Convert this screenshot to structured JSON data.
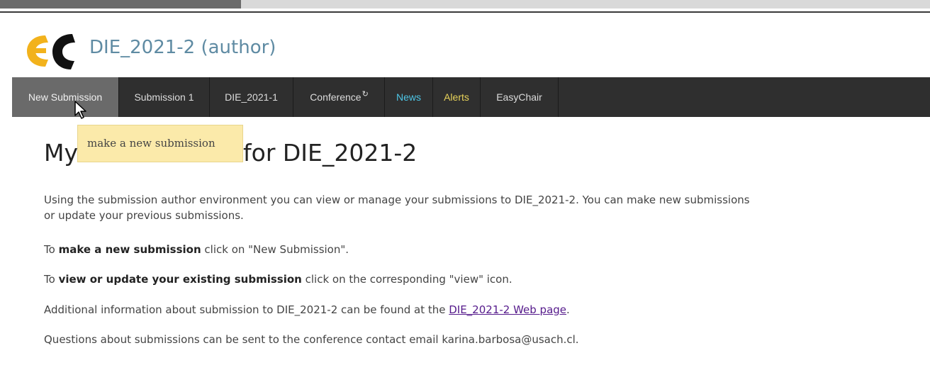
{
  "header": {
    "title": "DIE_2021-2 (author)"
  },
  "menu": {
    "items": [
      {
        "label": "New Submission"
      },
      {
        "label": "Submission 1"
      },
      {
        "label": "DIE_2021-1"
      },
      {
        "label": "Conference"
      },
      {
        "label": "News"
      },
      {
        "label": "Alerts"
      },
      {
        "label": "EasyChair"
      }
    ]
  },
  "tooltip": {
    "text": "make a new submission"
  },
  "page": {
    "heading_start": "My",
    "heading_end": "for DIE_2021-2",
    "intro_line1": "Using the submission author environment you can view or manage your submissions to DIE_2021-2. You can make new submissions",
    "intro_line2": "or update your previous submissions.",
    "new_prefix": "To ",
    "new_bold": "make a new submission",
    "new_suffix": " click on \"New Submission\".",
    "view_prefix": "To ",
    "view_bold": "view or update your existing submission",
    "view_suffix": " click on the corresponding \"view\" icon.",
    "info_prefix": "Additional information about submission to DIE_2021-2 can be found at the ",
    "info_link": "DIE_2021-2 Web page",
    "info_suffix": ".",
    "contact": "Questions about submissions can be sent to the conference contact email karina.barbosa@usach.cl."
  },
  "colors": {
    "menu_bg": "#2f2f2f",
    "menu_active": "#6a6a6a",
    "news": "#4ec6e6",
    "alerts": "#e8d35a",
    "title": "#5f8ba3",
    "tooltip_bg": "#fbeaaa",
    "link": "#551a8b"
  },
  "icons": {
    "logo": "easychair-logo",
    "cursor": "mouse-pointer-icon",
    "refresh": "refresh-icon"
  }
}
